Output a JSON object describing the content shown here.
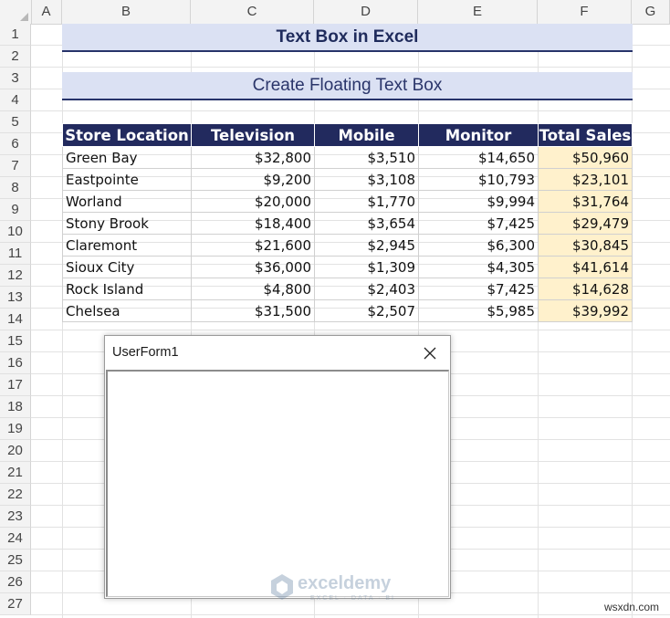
{
  "columns": [
    "A",
    "B",
    "C",
    "D",
    "E",
    "F",
    "G"
  ],
  "rows": [
    "1",
    "2",
    "3",
    "4",
    "5",
    "6",
    "7",
    "8",
    "9",
    "10",
    "11",
    "12",
    "13",
    "14",
    "15",
    "16",
    "17",
    "18",
    "19",
    "20",
    "21",
    "22",
    "23",
    "24",
    "25",
    "26",
    "27"
  ],
  "title": "Text Box in Excel",
  "subtitle": "Create Floating Text Box",
  "table": {
    "headers": [
      "Store Location",
      "Television",
      "Mobile",
      "Monitor",
      "Total Sales"
    ],
    "rows": [
      [
        "Green Bay",
        "$32,800",
        "$3,510",
        "$14,650",
        "$50,960"
      ],
      [
        "Eastpointe",
        "$9,200",
        "$3,108",
        "$10,793",
        "$23,101"
      ],
      [
        "Worland",
        "$20,000",
        "$1,770",
        "$9,994",
        "$31,764"
      ],
      [
        "Stony Brook",
        "$18,400",
        "$3,654",
        "$7,425",
        "$29,479"
      ],
      [
        "Claremont",
        "$21,600",
        "$2,945",
        "$6,300",
        "$30,845"
      ],
      [
        "Sioux City",
        "$36,000",
        "$1,309",
        "$4,305",
        "$41,614"
      ],
      [
        "Rock Island",
        "$4,800",
        "$2,403",
        "$7,425",
        "$14,628"
      ],
      [
        "Chelsea",
        "$31,500",
        "$2,507",
        "$5,985",
        "$39,992"
      ]
    ]
  },
  "userform": {
    "title": "UserForm1",
    "close_icon": "close-icon"
  },
  "watermark": {
    "brand": "exceldemy",
    "tagline": "EXCEL · DATA · BI"
  },
  "site_mark": "wsxdn.com",
  "colors": {
    "header_fill": "#222a5e",
    "banner_fill": "#dbe1f3",
    "total_fill": "#fff1cc"
  }
}
